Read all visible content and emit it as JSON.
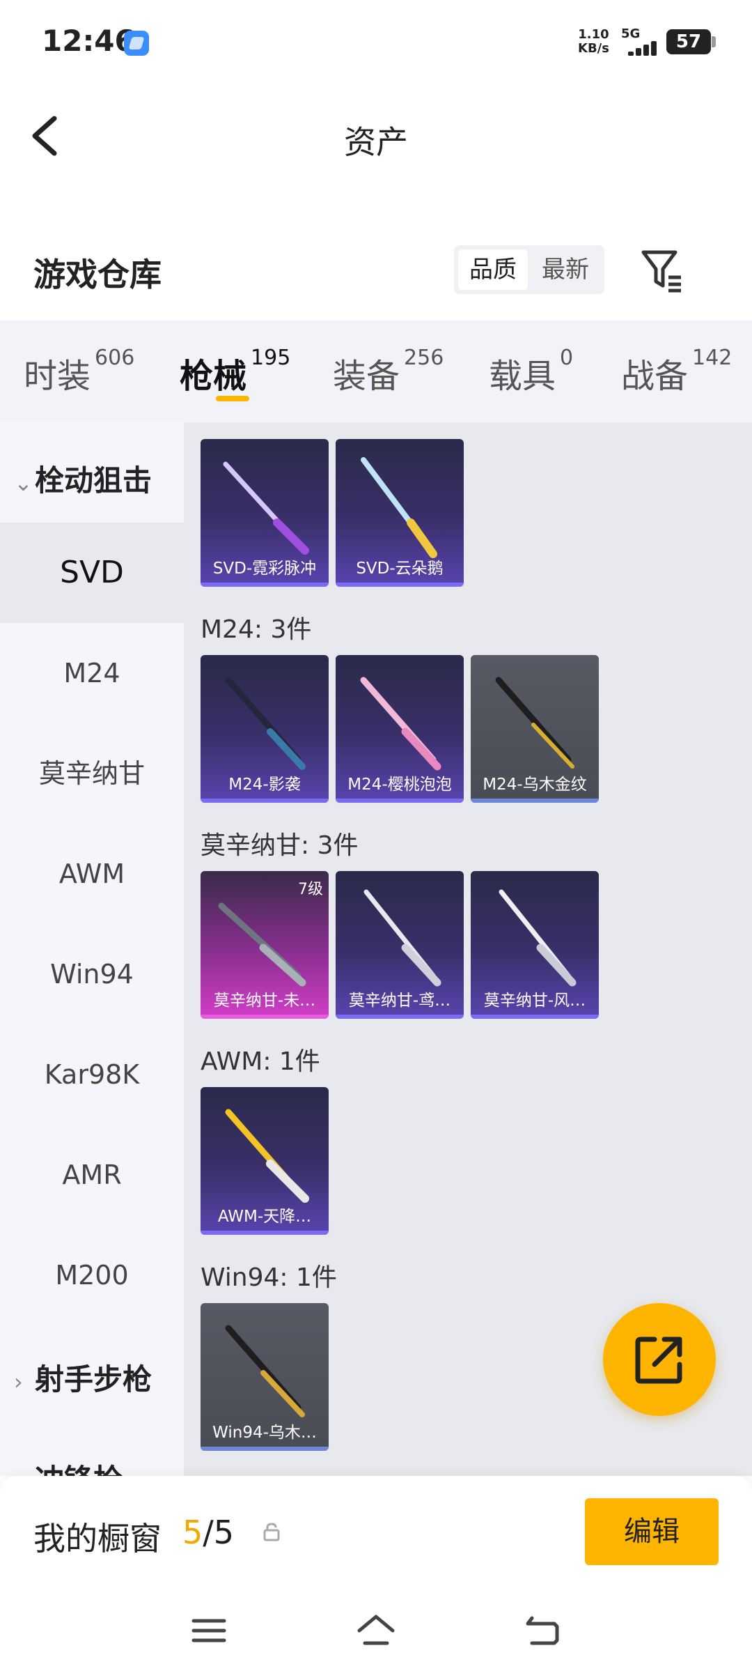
{
  "status_bar": {
    "time": "12:46",
    "net_speed_value": "1.10",
    "net_speed_unit": "KB/s",
    "network": "5G",
    "battery": "57"
  },
  "header": {
    "title": "资产"
  },
  "section": {
    "title": "游戏仓库",
    "sort_options": [
      "品质",
      "最新"
    ],
    "selected_sort": "品质"
  },
  "tabs": [
    {
      "label": "时装",
      "count": "606"
    },
    {
      "label": "枪械",
      "count": "195",
      "active": true
    },
    {
      "label": "装备",
      "count": "256"
    },
    {
      "label": "载具",
      "count": "0"
    },
    {
      "label": "战备",
      "count": "142"
    }
  ],
  "sidebar": {
    "group_open": "栓动狙击",
    "items": [
      "SVD",
      "M24",
      "莫辛纳甘",
      "AWM",
      "Win94",
      "Kar98K",
      "AMR",
      "M200"
    ],
    "active_item": "SVD",
    "group_closed": "射手步枪",
    "group_next_partial": "冲锋枪"
  },
  "content": {
    "groups": [
      {
        "label": "",
        "items": [
          {
            "name": "SVD-霓彩脉冲",
            "style": "purple"
          },
          {
            "name": "SVD-云朵鹅",
            "style": "purple"
          }
        ]
      },
      {
        "label": "M24: 3件",
        "items": [
          {
            "name": "M24-影袭",
            "style": "purple"
          },
          {
            "name": "M24-樱桃泡泡",
            "style": "purple"
          },
          {
            "name": "M24-乌木金纹",
            "style": "grey"
          }
        ]
      },
      {
        "label": "莫辛纳甘: 3件",
        "items": [
          {
            "name": "莫辛纳甘-未…",
            "style": "pink",
            "level": "7级"
          },
          {
            "name": "莫辛纳甘-鸢…",
            "style": "purple"
          },
          {
            "name": "莫辛纳甘-风…",
            "style": "purple"
          }
        ]
      },
      {
        "label": "AWM: 1件",
        "items": [
          {
            "name": "AWM-天降…",
            "style": "purple"
          }
        ]
      },
      {
        "label": "Win94: 1件",
        "items": [
          {
            "name": "Win94-乌木…",
            "style": "grey"
          }
        ]
      }
    ]
  },
  "showcase": {
    "label": "我的橱窗",
    "current": "5",
    "total": "/5",
    "edit_label": "编辑"
  },
  "colors": {
    "accent": "#ffb400",
    "content_bg": "#e7e9ee",
    "tab_bg": "#f1f3f8"
  },
  "icons": [
    "back-arrow-icon",
    "filter-icon",
    "share-external-icon",
    "lock-icon",
    "menu-icon",
    "home-icon",
    "back-nav-icon"
  ]
}
